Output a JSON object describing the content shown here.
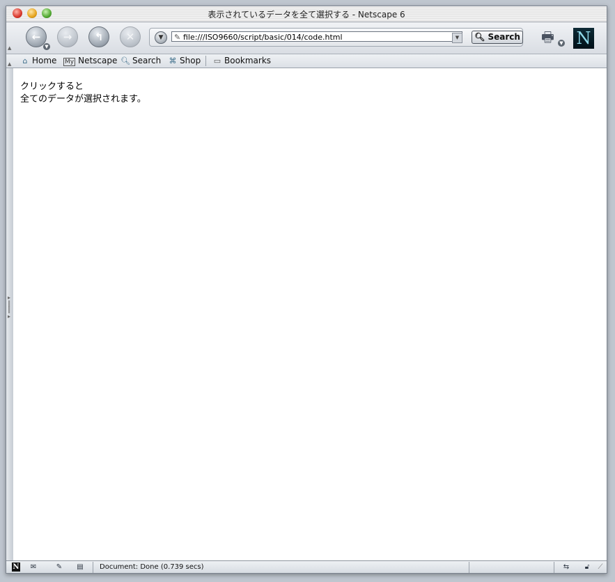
{
  "window": {
    "title": "表示されているデータを全て選択する - Netscape 6"
  },
  "toolbar": {
    "back_icon": "back-arrow-icon",
    "forward_icon": "forward-arrow-icon",
    "reload_icon": "reload-icon",
    "stop_icon": "stop-icon",
    "url": "file:///ISO9660/script/basic/014/code.html",
    "search_label": "Search"
  },
  "personal_toolbar": {
    "items": [
      {
        "label": "Home",
        "icon": "home-icon"
      },
      {
        "label": "Netscape",
        "icon": "my-netscape-icon"
      },
      {
        "label": "Search",
        "icon": "magnifier-icon"
      },
      {
        "label": "Shop",
        "icon": "shop-icon"
      }
    ],
    "bookmarks_label": "Bookmarks"
  },
  "content": {
    "lines": [
      "クリックすると",
      "全てのデータが選択されます。"
    ]
  },
  "status": {
    "text": "Document: Done (0.739 secs)"
  }
}
